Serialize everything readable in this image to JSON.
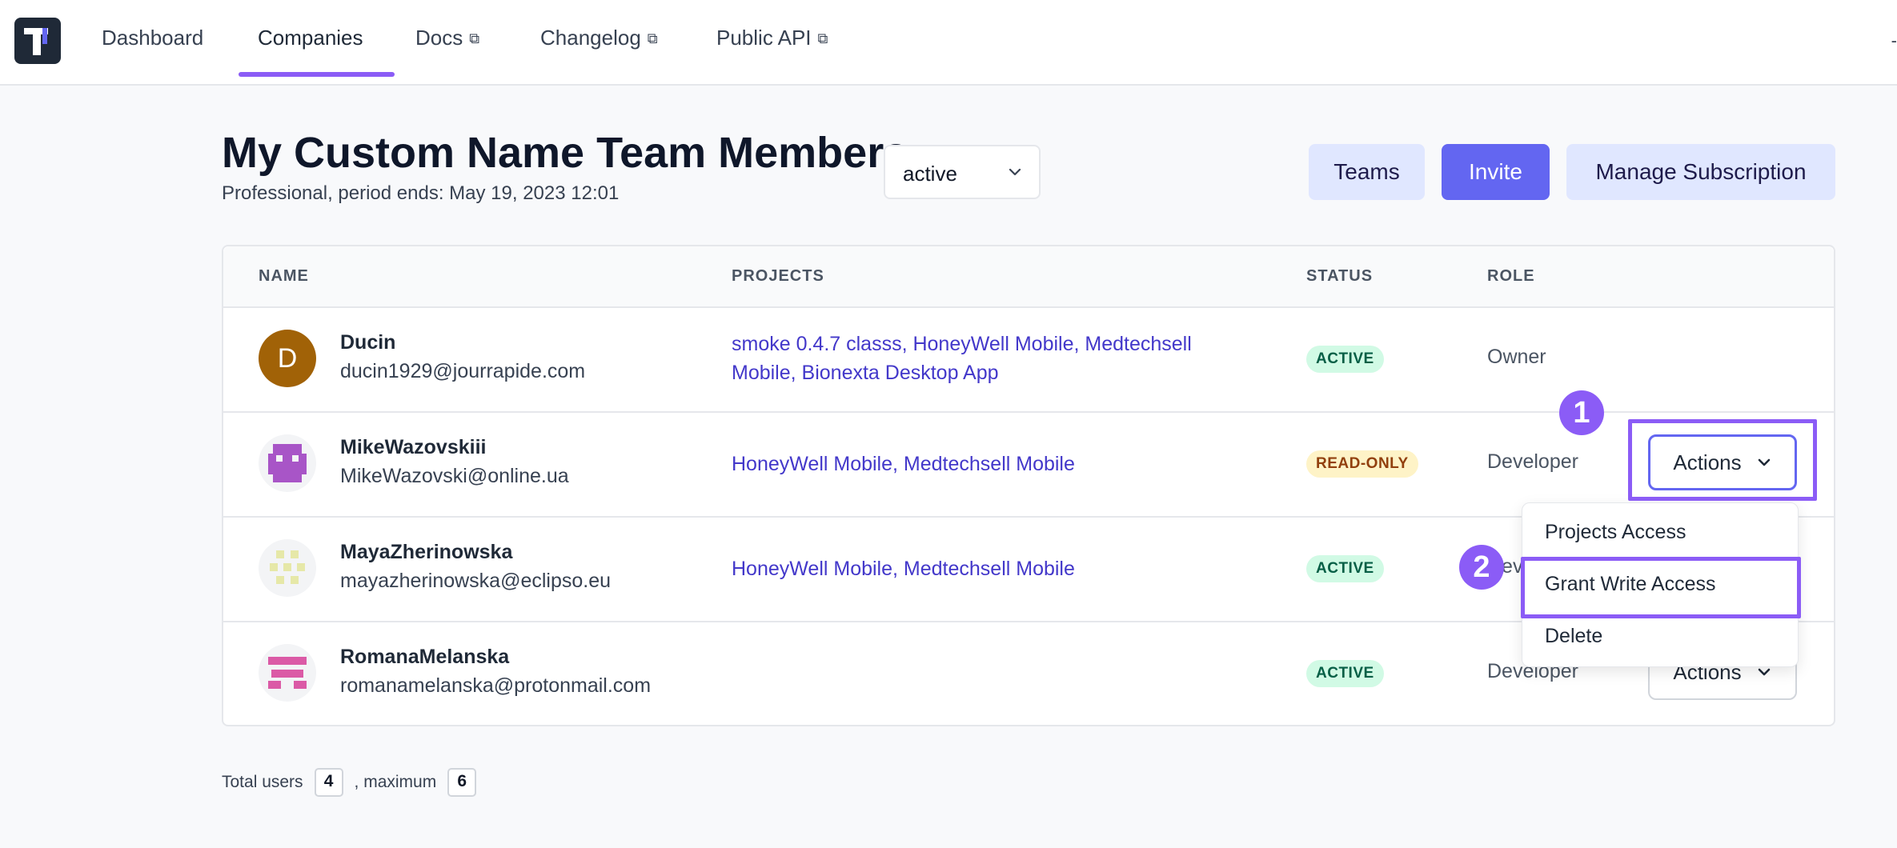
{
  "nav": {
    "items": [
      {
        "label": "Dashboard",
        "external": false
      },
      {
        "label": "Companies",
        "external": false,
        "active": true
      },
      {
        "label": "Docs",
        "external": true
      },
      {
        "label": "Changelog",
        "external": true
      },
      {
        "label": "Public API",
        "external": true
      }
    ],
    "external_glyph": "⧉"
  },
  "header": {
    "title": "My Custom Name Team Members",
    "subtitle": "Professional, period ends: May 19, 2023 12:01",
    "status_filter": "active",
    "buttons": {
      "teams": "Teams",
      "invite": "Invite",
      "manage": "Manage Subscription"
    }
  },
  "table": {
    "columns": {
      "name": "NAME",
      "projects": "PROJECTS",
      "status": "STATUS",
      "role": "ROLE"
    },
    "rows": [
      {
        "name": "Ducin",
        "email": "ducin1929@jourrapide.com",
        "avatar_letter": "D",
        "projects": "smoke 0.4.7 classs, HoneyWell Mobile, Medtechsell Mobile, Bionexta Desktop App",
        "status": "ACTIVE",
        "role": "Owner"
      },
      {
        "name": "MikeWazovskiii",
        "email": "MikeWazovski@online.ua",
        "projects": "HoneyWell Mobile, Medtechsell Mobile",
        "status": "READ-ONLY",
        "role": "Developer",
        "actions": "Actions"
      },
      {
        "name": "MayaZherinowska",
        "email": "mayazherinowska@eclipso.eu",
        "projects": "HoneyWell Mobile, Medtechsell Mobile",
        "status": "ACTIVE",
        "role": "Developer",
        "actions": "Actions"
      },
      {
        "name": "RomanaMelanska",
        "email": "romanamelanska@protonmail.com",
        "projects": "",
        "status": "ACTIVE",
        "role": "Developer",
        "actions": "Actions"
      }
    ]
  },
  "actions_menu": {
    "items": [
      "Projects Access",
      "Grant Write Access",
      "Delete"
    ]
  },
  "markers": [
    "1",
    "2"
  ],
  "footer": {
    "total_label": "Total users",
    "total": "4",
    "max_label": ", maximum",
    "max": "6"
  },
  "colors": {
    "accent": "#8b5cf6",
    "primary": "#6366f1",
    "link": "#4338ca"
  }
}
